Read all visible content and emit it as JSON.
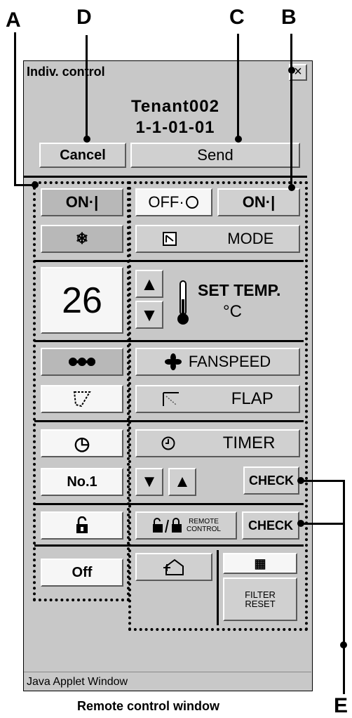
{
  "callouts": {
    "a": "A",
    "d": "D",
    "c": "C",
    "b": "B",
    "e": "E"
  },
  "window": {
    "title": "Indiv. control",
    "close": "×",
    "tenant": "Tenant002",
    "address": "1-1-01-01",
    "cancel": "Cancel",
    "send": "Send",
    "status_bar": "Java Applet Window"
  },
  "status_column": {
    "power": "ON·|",
    "mode_icon": "❄",
    "temperature": "26",
    "fan_icon": "fan-high-icon",
    "flap_icon": "flap-swing-icon",
    "timer_icon": "◷",
    "timer_number": "No.1",
    "lock_icon": "unlock-icon",
    "filter": "Off"
  },
  "controls": {
    "off": "OFF·",
    "on": "ON·|",
    "mode": "MODE",
    "set_temp": "SET TEMP.",
    "unit": "°C",
    "up": "▲",
    "down": "▼",
    "fanspeed": "FANSPEED",
    "flap": "FLAP",
    "timer": "TIMER",
    "check": "CHECK",
    "remote_top": "REMOTE",
    "remote_bottom": "CONTROL",
    "filter_reset_1": "FILTER",
    "filter_reset_2": "RESET",
    "grid_icon": "▦"
  },
  "caption": "Remote control window"
}
